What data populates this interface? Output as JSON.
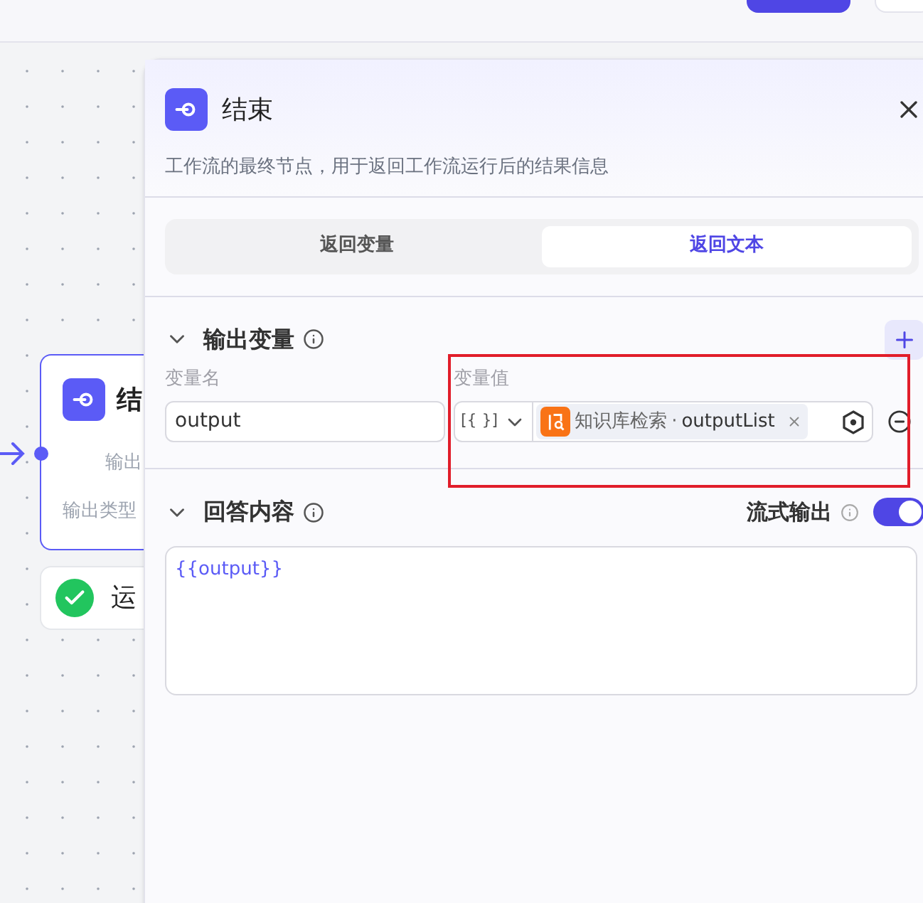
{
  "canvas": {
    "node": {
      "title": "结",
      "rows": [
        "输出",
        "输出类型"
      ]
    },
    "status": {
      "label": "运",
      "ok": true
    }
  },
  "panel": {
    "title": "结束",
    "description": "工作流的最终节点，用于返回工作流运行后的结果信息",
    "tabs": [
      {
        "label": "返回变量",
        "selected": false
      },
      {
        "label": "返回文本",
        "selected": true
      }
    ],
    "output_section": {
      "title": "输出变量",
      "expanded": true,
      "name_header": "变量名",
      "value_header": "变量值",
      "rows": [
        {
          "name": "output",
          "type_symbol": "[{ }]",
          "source": "知识库检索",
          "separator": "·",
          "variable": "outputList"
        }
      ]
    },
    "answer_section": {
      "title": "回答内容",
      "expanded": true,
      "stream_label": "流式输出",
      "stream_on": true,
      "content": "{{output}}"
    }
  }
}
